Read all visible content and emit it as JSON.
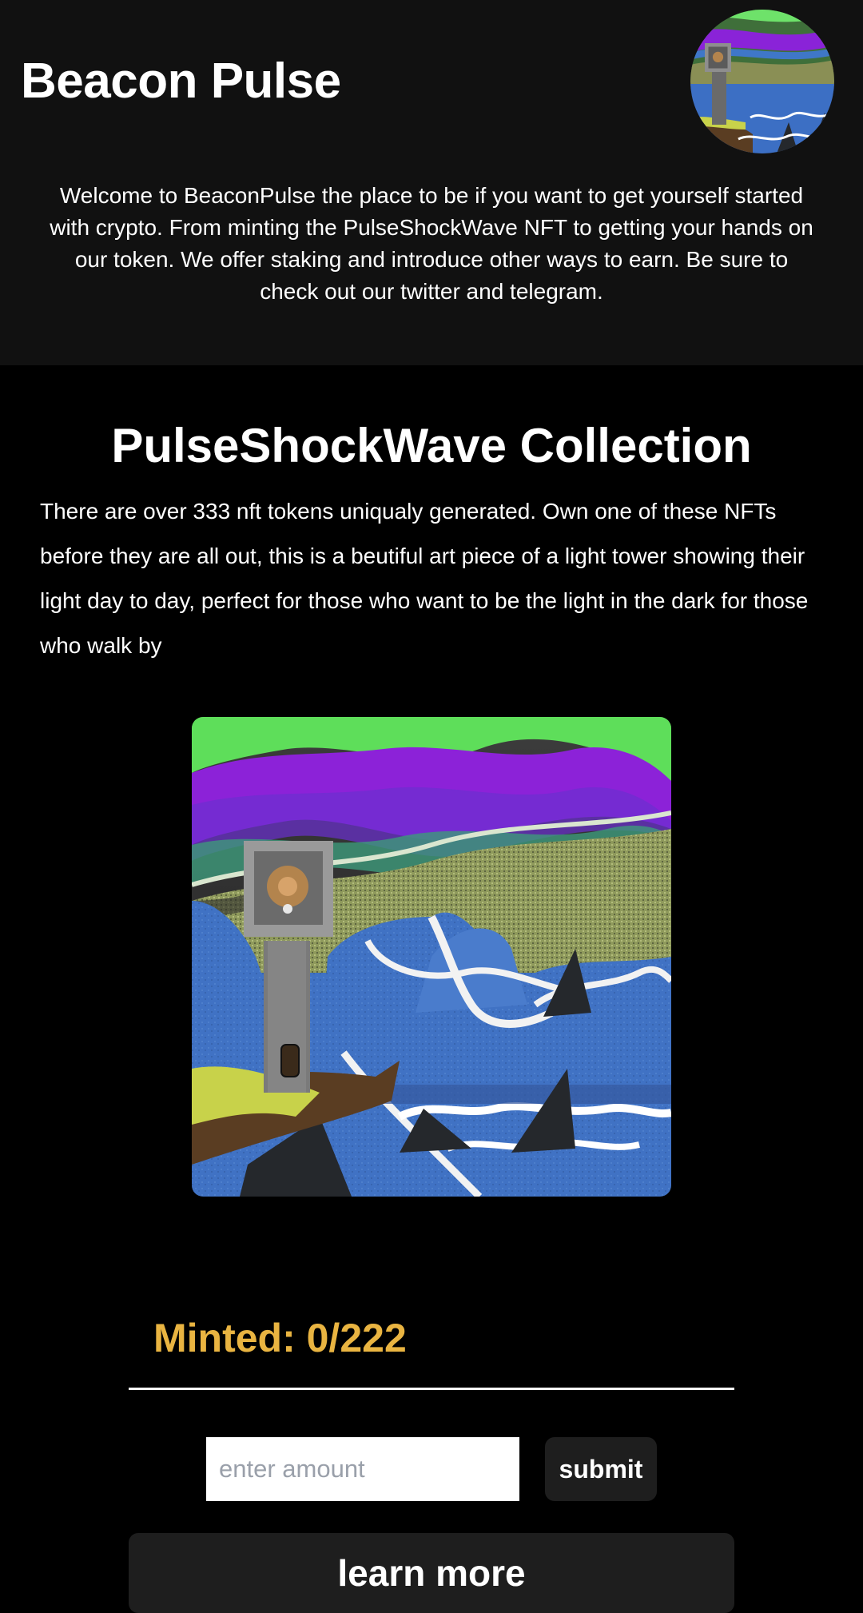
{
  "header": {
    "title": "Beacon Pulse",
    "intro": "Welcome to BeaconPulse the place to be if you want to get yourself started with crypto. From minting the PulseShockWave NFT to getting your hands on our token. We offer staking and introduce other ways to earn. Be sure to check out our twitter and telegram."
  },
  "collection": {
    "title": "PulseShockWave Collection",
    "description": "There are over 333 nft tokens uniqualy generated. Own one of these NFTs before they are all out, this is a beutiful art piece of a light tower showing their light day to day, perfect for those who want to be the light in the dark for those who walk by"
  },
  "mint": {
    "minted_text": "Minted: 0/222",
    "minted_count": 0,
    "minted_total": 222,
    "amount_placeholder": "enter amount",
    "amount_value": "",
    "submit_label": "submit"
  },
  "actions": {
    "learn_more_label": "learn more"
  },
  "colors": {
    "header_bg": "#111111",
    "page_bg": "#000000",
    "minted_accent": "#e9b441",
    "button_bg": "#1e1e1e"
  }
}
